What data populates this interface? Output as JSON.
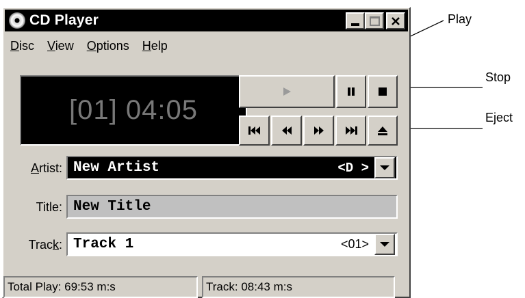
{
  "window": {
    "title": "CD Player",
    "icon": "cd-disc-icon"
  },
  "menu": [
    {
      "pre": "",
      "u": "D",
      "post": "isc"
    },
    {
      "pre": "",
      "u": "V",
      "post": "iew"
    },
    {
      "pre": "",
      "u": "O",
      "post": "ptions"
    },
    {
      "pre": "",
      "u": "H",
      "post": "elp"
    }
  ],
  "display": {
    "track_time": "[01] 04:05"
  },
  "fields": {
    "artist": {
      "label_u": "A",
      "label_rest": "rtist:",
      "value": "New Artist",
      "drive": "<D >"
    },
    "title": {
      "label": "Title:",
      "value": "New Title"
    },
    "track": {
      "label_pre": "Trac",
      "label_u": "k",
      "label_post": ":",
      "value": "Track 1",
      "number": "<01>"
    }
  },
  "status": {
    "total_play": "Total Play: 69:53 m:s",
    "track": "Track: 08:43 m:s"
  },
  "callouts": {
    "play": "Play",
    "stop": "Stop",
    "eject": "Eject"
  },
  "colors": {
    "lcd_bg": "#000000",
    "lcd_text": "#787878",
    "face": "#d4d0c8",
    "title_field": "#c0c0c0"
  }
}
